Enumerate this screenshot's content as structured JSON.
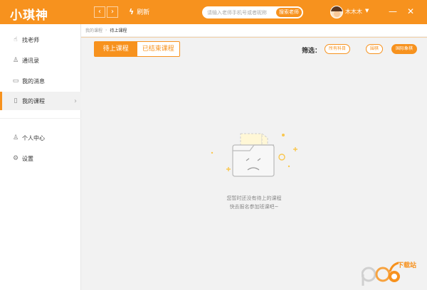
{
  "header": {
    "logo": "小琪神",
    "nav_back": "‹",
    "nav_forward": "›",
    "refresh_label": "刷新",
    "search_placeholder": "请输入老师手机号或者昵称",
    "search_button": "搜索老师",
    "username": "木木木",
    "min_button": "—",
    "close_button": "✕"
  },
  "sidebar": {
    "items": [
      {
        "label": "找老师"
      },
      {
        "label": "通讯录"
      },
      {
        "label": "我的消息"
      },
      {
        "label": "我的课程"
      },
      {
        "label": "个人中心"
      },
      {
        "label": "设置"
      }
    ]
  },
  "breadcrumb": {
    "parent": "我的课程",
    "separator": "›",
    "current": "待上课程"
  },
  "tabs": [
    {
      "label": "待上课程",
      "active": true
    },
    {
      "label": "已结束课程",
      "active": false
    }
  ],
  "filter": {
    "label": "筛选：",
    "chips": [
      {
        "label": "所有科目",
        "active": false
      },
      {
        "label": "围棋",
        "active": false
      },
      {
        "label": "国际象棋",
        "active": true
      }
    ]
  },
  "empty": {
    "line1": "您暂时还没有待上的课程",
    "line2": "快去报名参加班课吧~"
  },
  "watermark": {
    "brand": "pc6",
    "sub": "下载站"
  },
  "colors": {
    "accent": "#f7921e",
    "background": "#f2f2f2",
    "sidebar": "#ffffff"
  }
}
